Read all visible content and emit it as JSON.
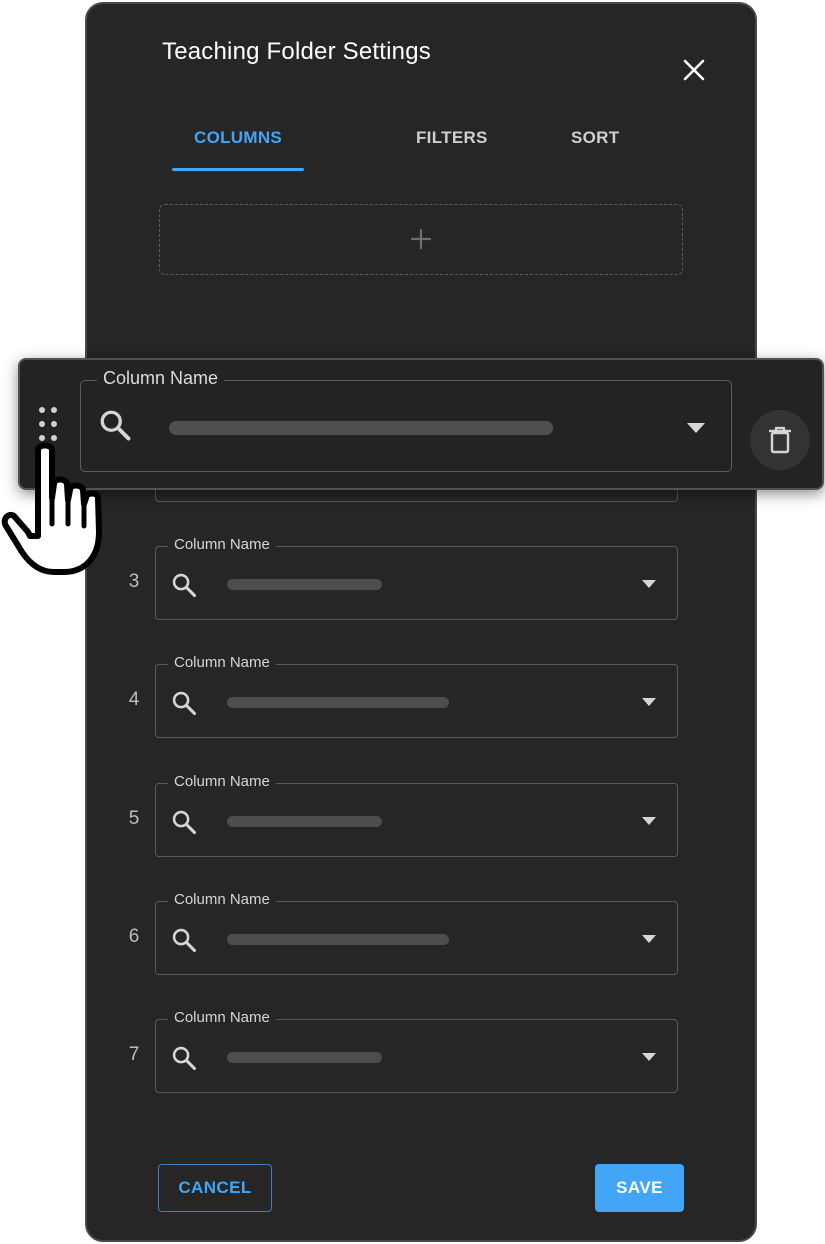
{
  "dialog": {
    "title": "Teaching Folder Settings"
  },
  "tabs": [
    {
      "label": "COLUMNS",
      "active": true
    },
    {
      "label": "FILTERS",
      "active": false
    },
    {
      "label": "SORT",
      "active": false
    }
  ],
  "add_zone": {
    "icon": "plus-icon"
  },
  "dragging_row": {
    "label": "Column Name",
    "icons": [
      "drag-handle-icon",
      "search-icon",
      "chevron-down-icon",
      "trash-icon"
    ]
  },
  "rows": [
    {
      "number": "3",
      "label": "Column Name",
      "bar_fraction": 0.42
    },
    {
      "number": "4",
      "label": "Column Name",
      "bar_fraction": 0.6
    },
    {
      "number": "5",
      "label": "Column Name",
      "bar_fraction": 0.42
    },
    {
      "number": "6",
      "label": "Column Name",
      "bar_fraction": 0.6
    },
    {
      "number": "7",
      "label": "Column Name",
      "bar_fraction": 0.42
    }
  ],
  "footer": {
    "cancel_label": "CANCEL",
    "save_label": "SAVE"
  },
  "colors": {
    "accent": "#42a5f5",
    "panel": "#262626"
  }
}
